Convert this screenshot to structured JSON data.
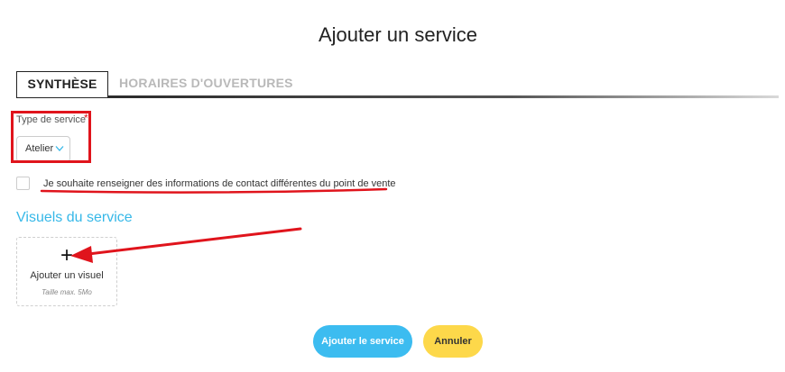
{
  "dialog": {
    "title": "Ajouter un service"
  },
  "tabs": [
    {
      "label": "SYNTHÈSE",
      "active": true
    },
    {
      "label": "HORAIRES D'OUVERTURES",
      "active": false
    }
  ],
  "service_type": {
    "label": "Type de service",
    "required_marker": "*",
    "value": "Atelier"
  },
  "contact_checkbox": {
    "label": "Je souhaite renseigner des informations de contact différentes du point de vente",
    "checked": false
  },
  "visuals": {
    "title": "Visuels du service",
    "add_icon": "plus-icon",
    "add_label": "Ajouter un visuel",
    "hint": "Taille max. 5Mo"
  },
  "actions": {
    "submit_label": "Ajouter le service",
    "cancel_label": "Annuler"
  },
  "colors": {
    "accent_blue": "#3cbcf0",
    "cancel_yellow": "#fdd84a",
    "annotation_red": "#e0141c",
    "section_title": "#36b8e8"
  }
}
